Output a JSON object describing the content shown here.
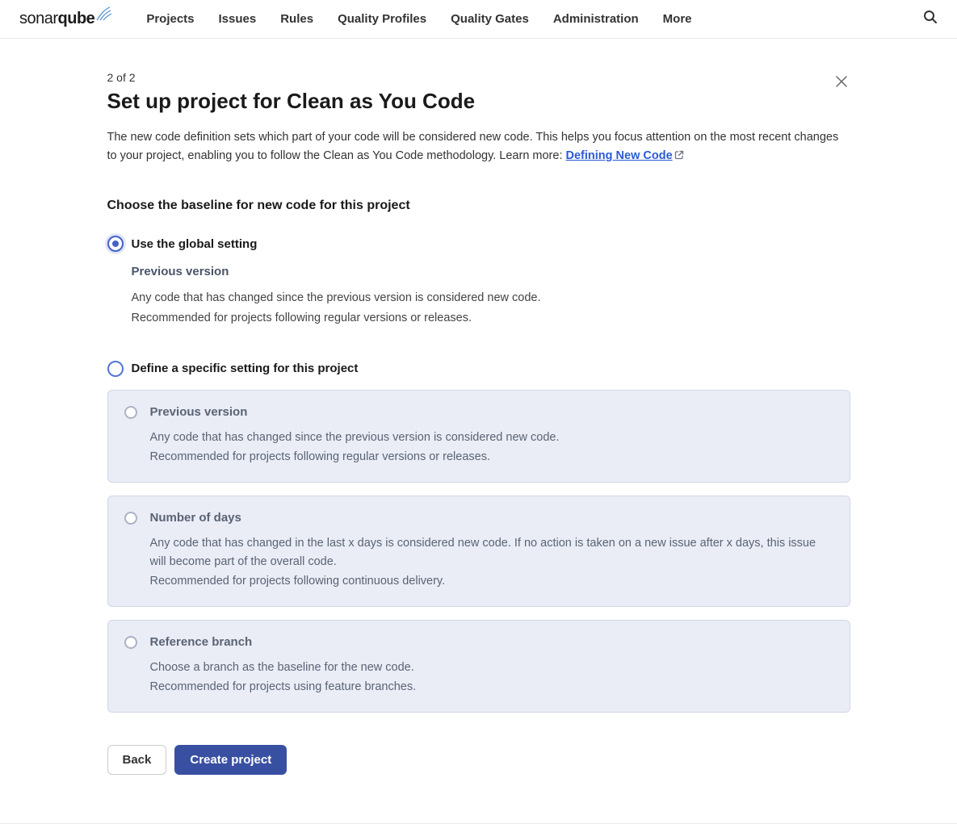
{
  "nav": {
    "logo_part1": "sonar",
    "logo_part2": "qube",
    "items": [
      "Projects",
      "Issues",
      "Rules",
      "Quality Profiles",
      "Quality Gates",
      "Administration",
      "More"
    ]
  },
  "step": "2 of 2",
  "title": "Set up project for Clean as You Code",
  "description_pre": "The new code definition sets which part of your code will be considered new code. This helps you focus attention on the most recent changes to your project, enabling you to follow the Clean as You Code methodology. Learn more: ",
  "description_link": "Defining New Code",
  "subheading": "Choose the baseline for new code for this project",
  "option_global": {
    "label": "Use the global setting",
    "detail_title": "Previous version",
    "line1": "Any code that has changed since the previous version is considered new code.",
    "line2": "Recommended for projects following regular versions or releases."
  },
  "option_specific": {
    "label": "Define a specific setting for this project"
  },
  "cards": [
    {
      "title": "Previous version",
      "line1": "Any code that has changed since the previous version is considered new code.",
      "line2": "Recommended for projects following regular versions or releases."
    },
    {
      "title": "Number of days",
      "line1": "Any code that has changed in the last x days is considered new code. If no action is taken on a new issue after x days, this issue will become part of the overall code.",
      "line2": "Recommended for projects following continuous delivery."
    },
    {
      "title": "Reference branch",
      "line1": "Choose a branch as the baseline for the new code.",
      "line2": "Recommended for projects using feature branches."
    }
  ],
  "buttons": {
    "back": "Back",
    "create": "Create project"
  }
}
